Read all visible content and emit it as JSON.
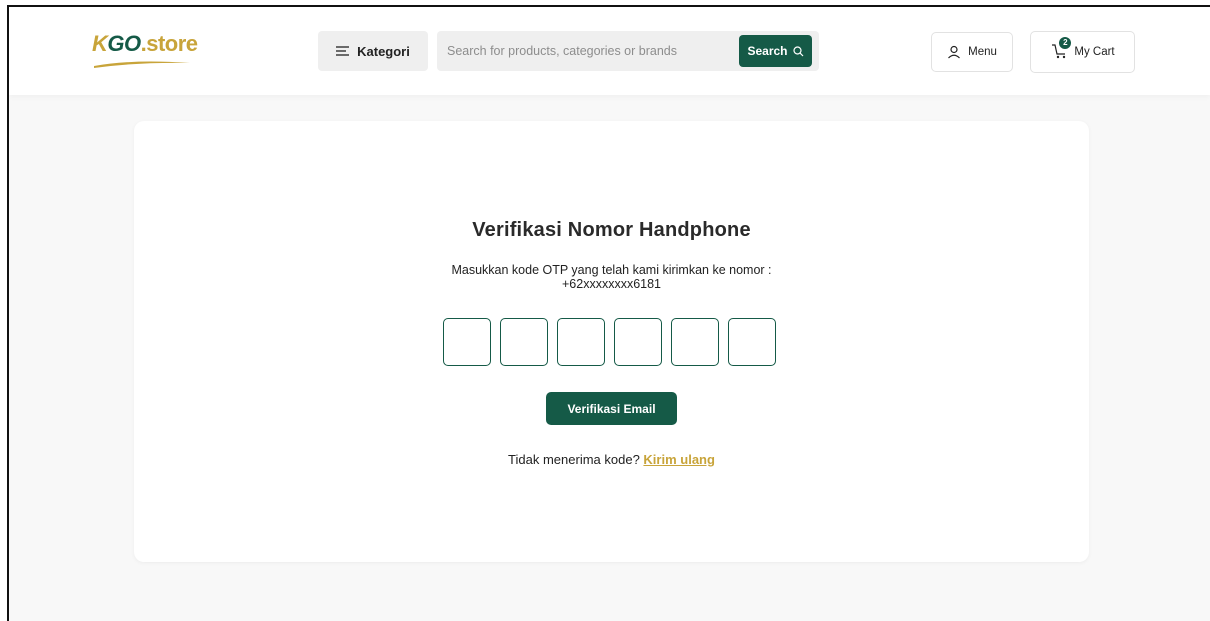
{
  "header": {
    "logo": {
      "k": "K",
      "go": "GO",
      "store": ".store"
    },
    "kategori_label": "Kategori",
    "search": {
      "placeholder": "Search for products, categories or brands",
      "value": "",
      "button_label": "Search"
    },
    "menu_label": "Menu",
    "cart": {
      "label": "My Cart",
      "count": "2"
    }
  },
  "verification": {
    "title": "Verifikasi Nomor Handphone",
    "instruction_line1": "Masukkan kode OTP yang telah kami kirimkan ke nomor :",
    "phone_masked": "+62xxxxxxxx6181",
    "otp_digits": [
      "",
      "",
      "",
      "",
      "",
      ""
    ],
    "verify_button_label": "Verifikasi Email",
    "resend_prompt": "Tidak menerima kode?",
    "resend_link_label": "Kirim ulang"
  },
  "colors": {
    "primary_green": "#155a47",
    "accent_gold": "#c8a43a",
    "page_bg": "#f8f8f8"
  },
  "icons": [
    "hamburger-icon",
    "search-icon",
    "user-icon",
    "cart-icon"
  ]
}
